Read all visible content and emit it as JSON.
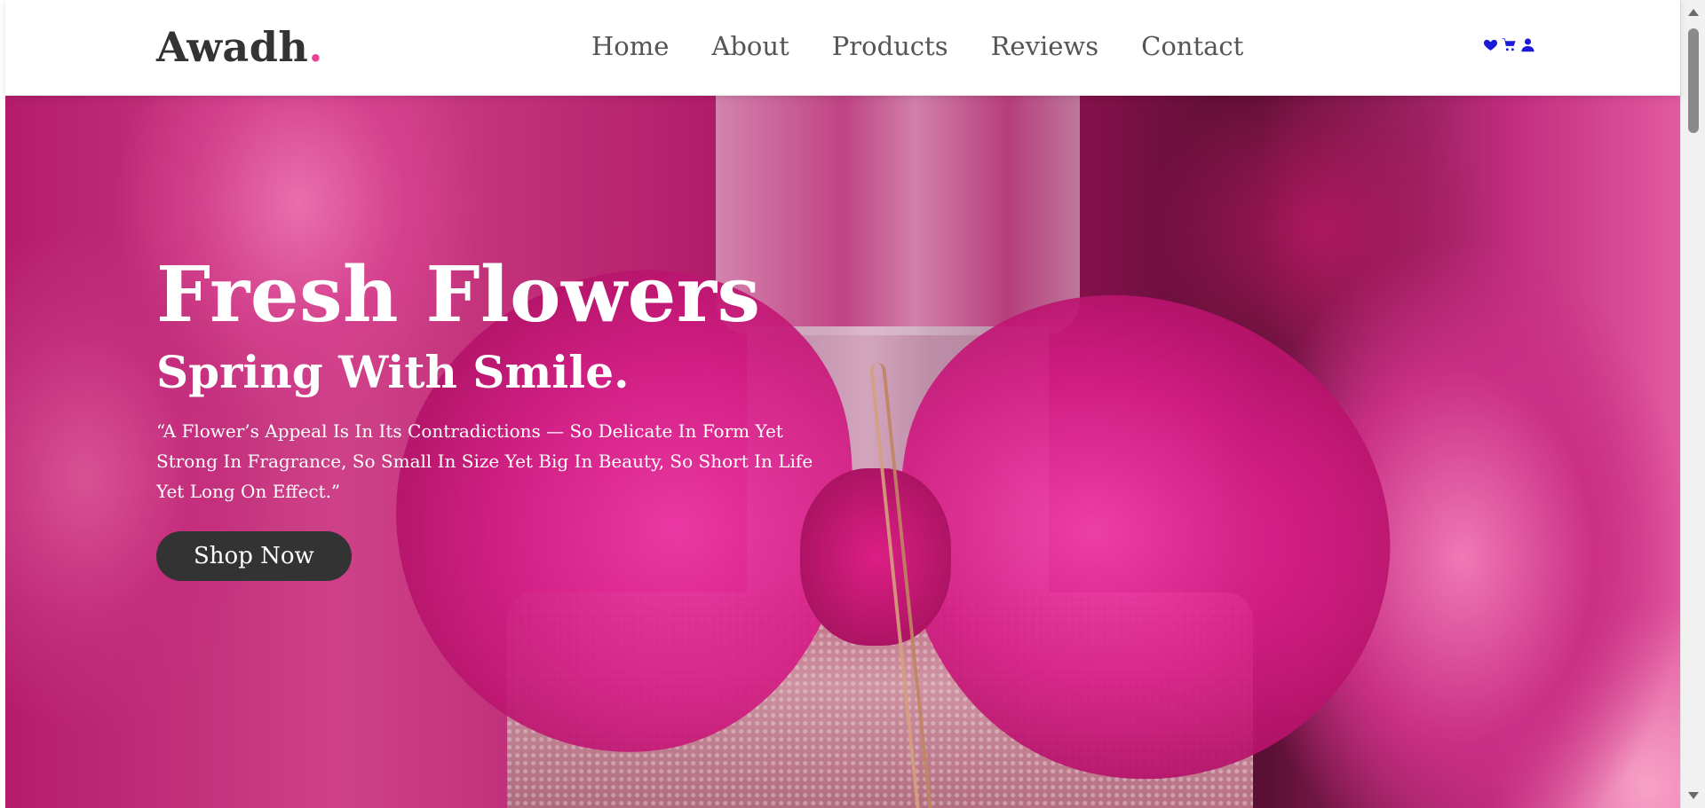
{
  "brand": {
    "name": "Awadh",
    "dot": "."
  },
  "nav": {
    "items": [
      {
        "label": "Home"
      },
      {
        "label": "About"
      },
      {
        "label": "Products"
      },
      {
        "label": "Reviews"
      },
      {
        "label": "Contact"
      }
    ]
  },
  "header_icons": {
    "wishlist": "heart-icon",
    "cart": "shopping-cart-icon",
    "account": "user-icon",
    "color": "#1a1ad8"
  },
  "hero": {
    "title": "Fresh Flowers",
    "subtitle": "Spring With Smile.",
    "quote": "“A Flower’s Appeal Is In Its Contradictions — So Delicate In Form Yet Strong In Fragrance, So Small In Size Yet Big In Beauty, So Short In Life Yet Long On Effect.”",
    "cta_label": "Shop Now"
  },
  "colors": {
    "accent": "#e84393",
    "button_bg": "#333333",
    "text_dark": "#333333",
    "nav_text": "#555555"
  }
}
